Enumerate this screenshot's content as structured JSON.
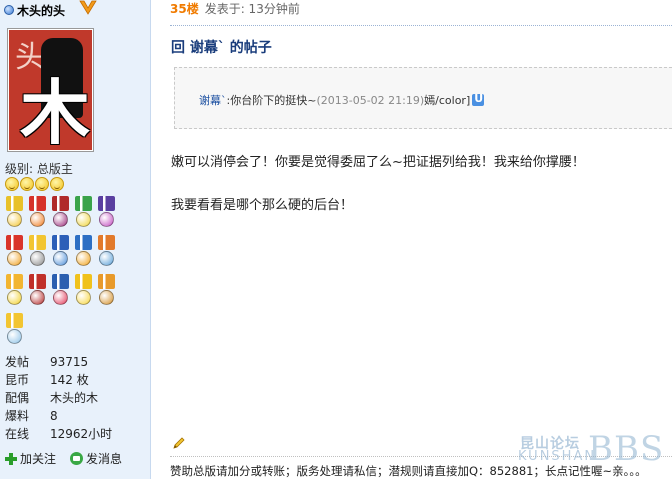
{
  "user": {
    "name": "木头的头",
    "avatar_chars": {
      "top": "头",
      "big": "木"
    },
    "level": "级别: 总版主",
    "smiley_count": 4,
    "medals": [
      {
        "ribbon": "#e8c12a",
        "disc": "#f3c531"
      },
      {
        "ribbon": "#d6322b",
        "disc": "#f07a1e"
      },
      {
        "ribbon": "#b02a2a",
        "disc": "#9b2b7a"
      },
      {
        "ribbon": "#3aa34a",
        "disc": "#f0d43a"
      },
      {
        "ribbon": "#5a3fa0",
        "disc": "#c24cc0"
      },
      {
        "ribbon": "#d9342b",
        "disc": "#f0a020"
      },
      {
        "ribbon": "#f2c531",
        "disc": "#8a8a8a"
      },
      {
        "ribbon": "#2c5fb8",
        "disc": "#4c8ed8"
      },
      {
        "ribbon": "#2d6fc4",
        "disc": "#f2a31c"
      },
      {
        "ribbon": "#e27a2b",
        "disc": "#5aa0d8"
      },
      {
        "ribbon": "#f2b531",
        "disc": "#f2d12c"
      },
      {
        "ribbon": "#c0302a",
        "disc": "#b32a2a"
      },
      {
        "ribbon": "#2b5fb0",
        "disc": "#e23a5a"
      },
      {
        "ribbon": "#f0c21c",
        "disc": "#f7d53c"
      },
      {
        "ribbon": "#e89a2a",
        "disc": "#d4902a"
      },
      {
        "ribbon": "#f2c531",
        "disc": "#8fc3e8"
      }
    ],
    "stats": [
      {
        "label": "发帖",
        "value": "93715"
      },
      {
        "label": "昆币",
        "value": "142 枚"
      },
      {
        "label": "配偶",
        "value": "木头的木"
      },
      {
        "label": "爆料",
        "value": "8"
      },
      {
        "label": "在线",
        "value": "12962小时"
      }
    ],
    "actions": {
      "follow": "加关注",
      "message": "发消息"
    }
  },
  "post": {
    "floor": "35楼",
    "posted": "发表于: 13分钟前",
    "title": "回 谢幕` 的帖子",
    "quote": {
      "author": "谢幕`",
      "text": ":你台阶下的挺快~",
      "time": "(2013-05-02 21:19)",
      "tail": "嫣/color]"
    },
    "body": [
      "嫩可以消停会了！你要是觉得委屈了么~把证据列给我！我来给你撑腰！",
      "我要看看是哪个那么硬的后台！"
    ],
    "signature": "赞助总版请加分或转账；版务处理请私信；潜规则请直接加Q：852881；长点记性喔~亲。。。"
  },
  "watermark": {
    "cn": "昆山论坛",
    "en": "KUNSHAN",
    "bbs": "BBS"
  }
}
